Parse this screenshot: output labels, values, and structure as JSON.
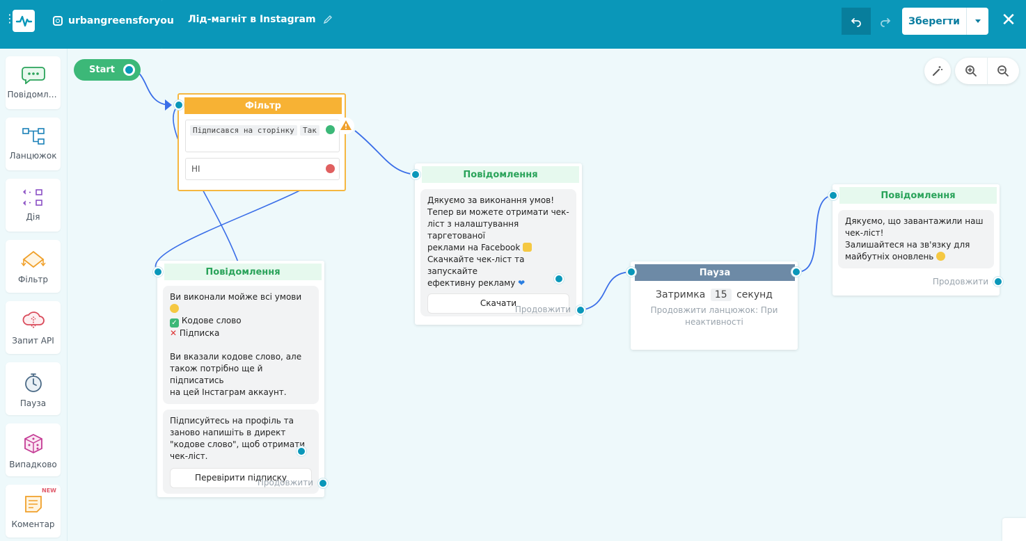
{
  "header": {
    "account": "urbangreensforyou",
    "flow_title": "Лід-магніт в Instagram",
    "save_label": "Зберегти"
  },
  "sidebar": {
    "items": [
      {
        "label": "Повідомлення",
        "icon": "chat-bubble-icon"
      },
      {
        "label": "Ланцюжок",
        "icon": "chain-icon"
      },
      {
        "label": "Дія",
        "icon": "action-icon"
      },
      {
        "label": "Фільтр",
        "icon": "filter-icon"
      },
      {
        "label": "Запит API",
        "icon": "api-cloud-icon"
      },
      {
        "label": "Пауза",
        "icon": "stopwatch-icon"
      },
      {
        "label": "Випадково",
        "icon": "dice-icon"
      },
      {
        "label": "Коментар",
        "icon": "comment-note-icon",
        "badge": "NEW"
      }
    ]
  },
  "canvas": {
    "start_label": "Start",
    "filter": {
      "title": "Фільтр",
      "condition_tag": "Підписався на сторінку",
      "condition_value": "Так",
      "no_label": "НІ"
    },
    "message1": {
      "title": "Повідомлення",
      "lines": [
        "Дякуємо за виконання умов!",
        "Тепер ви можете отримати чек-",
        "ліст з налаштування таргетованої",
        "реклами на Facebook",
        "Скачкайте чек-ліст та запускайте",
        "ефективну рекламу"
      ],
      "button": "Скачати",
      "continue": "Продовжити"
    },
    "message2": {
      "title": "Повідомлення",
      "lines1": [
        "Ви виконали мойже всі умови",
        "Кодове слово",
        "Підписка",
        "",
        "Ви вказали кодове слово, але",
        "також потрібно ще й підписатись",
        "на цей Інстаграм аккаунт."
      ],
      "lines2": [
        "Підписуйтесь на профіль та",
        "заново напишіть в директ",
        "\"кодове слово\",  щоб отримати",
        "чек-ліст."
      ],
      "button": "Перевірити підписку",
      "continue": "Продовжити"
    },
    "pause": {
      "title": "Пауза",
      "delay_label": "Затримка",
      "delay_value": "15",
      "delay_unit": "секунд",
      "note_line1": "Продовжити ланцюжок: При",
      "note_line2": "неактивності"
    },
    "message3": {
      "title": "Повідомлення",
      "lines": [
        "Дякуємо, що завантажили наш",
        "чек-ліст!",
        "Залишайтеся на зв'язку для",
        "майбутніх оновлень"
      ],
      "continue": "Продовжити"
    }
  },
  "colors": {
    "header": "#0a97b9",
    "accent_green": "#3cb878",
    "filter_orange": "#f7b234",
    "pause_slate": "#6d8aa6",
    "wire_blue": "#3a6ee8"
  }
}
